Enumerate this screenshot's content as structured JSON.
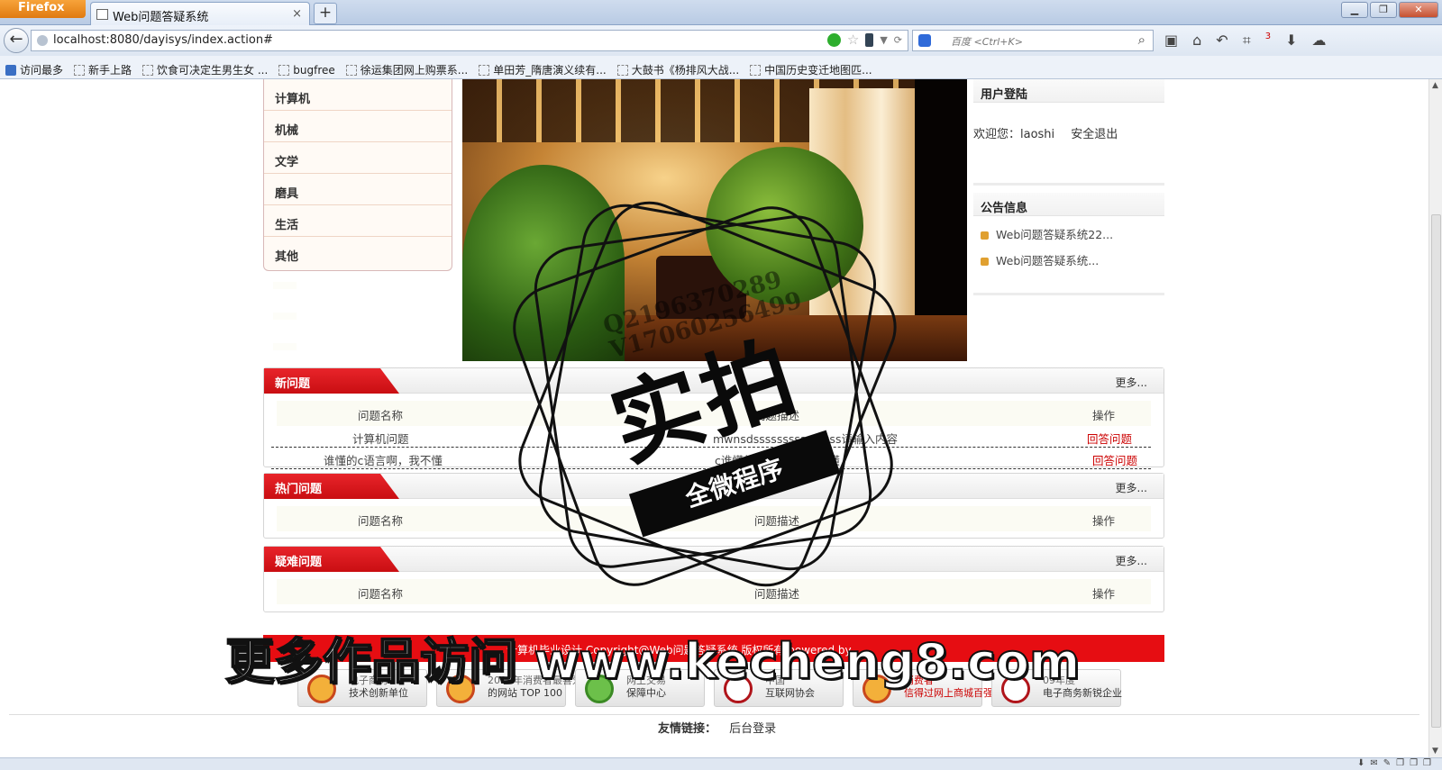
{
  "browser": {
    "app_button": "Firefox",
    "tab_title": "Web问题答疑系统",
    "tab_close": "×",
    "new_tab": "+",
    "window_controls": [
      "▁",
      "❐",
      "✕"
    ],
    "url": "localhost:8080/dayisys/index.action#",
    "search_placeholder": "百度 <Ctrl+K>",
    "bookmarks": [
      "访问最多",
      "新手上路",
      "饮食可决定生男生女 ...",
      "bugfree",
      "徐运集团网上购票系...",
      "单田芳_隋唐演义续有...",
      "大鼓书《杨排风大战...",
      "中国历史变迁地图匹..."
    ],
    "notification_count": "3"
  },
  "categories": [
    "计算机",
    "机械",
    "文学",
    "磨具",
    "生活",
    "其他"
  ],
  "login": {
    "title": "用户登陆",
    "welcome": "欢迎您：laoshi",
    "logout": "安全退出"
  },
  "notices": {
    "title": "公告信息",
    "items": [
      "Web问题答疑系统22...",
      "Web问题答疑系统..."
    ]
  },
  "panels": {
    "new": {
      "title": "新问题",
      "more": "更多...",
      "columns": [
        "问题名称",
        "问题描述",
        "操作"
      ],
      "rows": [
        {
          "name": "计算机问题",
          "desc": "mwnsdsssssssssssssss请输入内容",
          "action": "回答问题"
        },
        {
          "name": "谁懂的c语言啊，我不懂",
          "desc": "c谁懂的c语言啊，我不懂",
          "action": "回答问题"
        }
      ]
    },
    "hot": {
      "title": "热门问题",
      "more": "更多...",
      "columns": [
        "问题名称",
        "问题描述",
        "操作"
      ]
    },
    "hard": {
      "title": "疑难问题",
      "more": "更多...",
      "columns": [
        "问题名称",
        "问题描述",
        "操作"
      ]
    }
  },
  "footer": {
    "copyright": "计算机毕业设计 Copyright@Web问题答疑系统 版权所有 powered by",
    "badges": [
      {
        "line1": "电子商务",
        "line2": "技术创新单位"
      },
      {
        "line1": "2009年消费者最喜爱",
        "line2": "的网站 TOP 100"
      },
      {
        "line1": "网上交易",
        "line2": "保障中心"
      },
      {
        "line1": "中国",
        "line2": "互联网协会"
      },
      {
        "line1": "消费者",
        "line2": "信得过网上商城百强"
      },
      {
        "line1": "09年度",
        "line2": "电子商务新锐企业"
      }
    ],
    "friend_links_label": "友情链接：",
    "friend_links": [
      "后台登录"
    ]
  },
  "watermark": {
    "stamp_text": "实拍",
    "ribbon_text": "全微程序",
    "contact_line1": "Q2196370289",
    "contact_line2": "V17060256499",
    "site": "更多作品访问 www.kecheng8.com"
  }
}
